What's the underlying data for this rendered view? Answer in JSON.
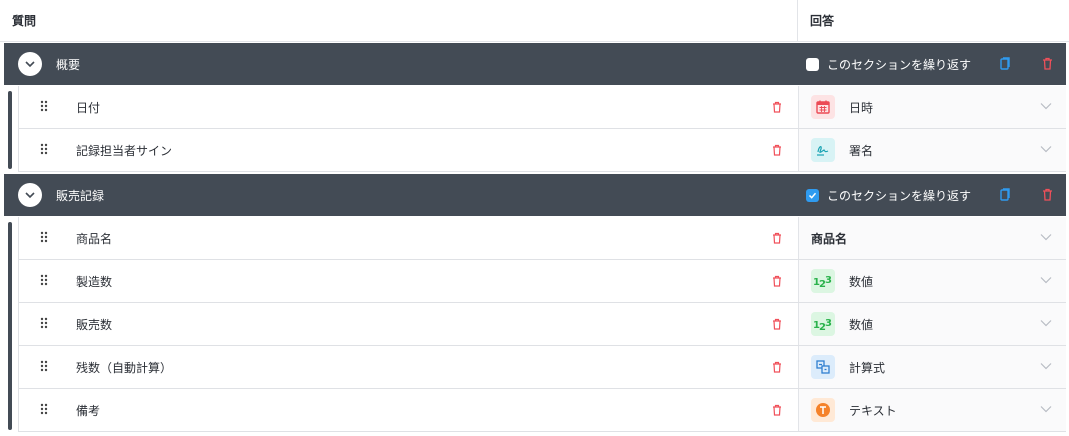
{
  "header": {
    "question_label": "質問",
    "answer_label": "回答"
  },
  "sections": [
    {
      "title": "概要",
      "repeat_label": "このセクションを繰り返す",
      "repeat_checked": false,
      "rows": [
        {
          "label": "日付",
          "answer": "日時",
          "answer_icon": "calendar-icon"
        },
        {
          "label": "記録担当者サイン",
          "answer": "署名",
          "answer_icon": "signature-icon"
        }
      ]
    },
    {
      "title": "販売記録",
      "repeat_label": "このセクションを繰り返す",
      "repeat_checked": true,
      "rows": [
        {
          "label": "商品名",
          "answer": "商品名",
          "answer_icon": ""
        },
        {
          "label": "製造数",
          "answer": "数値",
          "answer_icon": "number-icon"
        },
        {
          "label": "販売数",
          "answer": "数値",
          "answer_icon": "number-icon"
        },
        {
          "label": "残数（自動計算）",
          "answer": "計算式",
          "answer_icon": "formula-icon"
        },
        {
          "label": "備考",
          "answer": "テキスト",
          "answer_icon": "text-icon"
        }
      ]
    }
  ],
  "colors": {
    "section_bg": "#434b55",
    "accent_blue": "#2f9bf0",
    "delete_red": "#f0505a"
  }
}
